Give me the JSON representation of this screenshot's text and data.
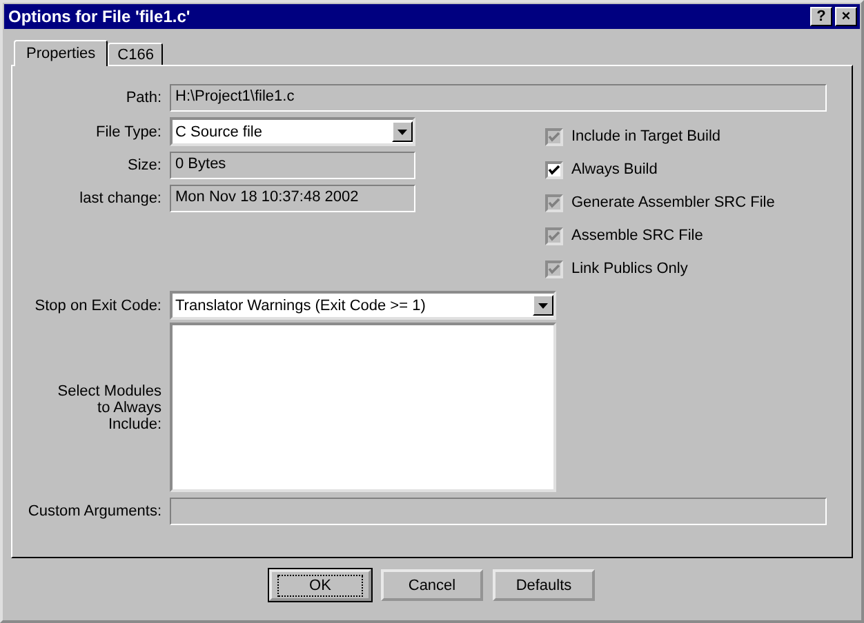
{
  "window": {
    "title": "Options for File 'file1.c'",
    "title_buttons": [
      "?",
      "×"
    ]
  },
  "tabs": [
    {
      "label": "Properties",
      "selected": true
    },
    {
      "label": "C166",
      "selected": false
    }
  ],
  "fields": {
    "path": {
      "label": "Path:",
      "value": "H:\\Project1\\file1.c"
    },
    "file_type": {
      "label": "File Type:",
      "value": "C Source file"
    },
    "size": {
      "label": "Size:",
      "value": "0 Bytes"
    },
    "last_change": {
      "label": "last change:",
      "value": "Mon Nov 18 10:37:48 2002"
    },
    "stop_on_exit_code": {
      "label": "Stop on Exit Code:",
      "value": "Translator Warnings (Exit Code >= 1)"
    },
    "modules": {
      "label": "Select Modules to Always Include:"
    },
    "custom_arguments": {
      "label": "Custom Arguments:"
    }
  },
  "options": [
    {
      "label": "Include in Target Build",
      "checked": true,
      "disabled": true
    },
    {
      "label": "Always Build",
      "checked": true,
      "disabled": false
    },
    {
      "label": "Generate Assembler SRC File",
      "checked": true,
      "disabled": true
    },
    {
      "label": "Assemble SRC File",
      "checked": true,
      "disabled": true
    },
    {
      "label": "Link Publics Only",
      "checked": true,
      "disabled": true
    }
  ],
  "buttons": [
    {
      "label": "OK",
      "default": true
    },
    {
      "label": "Cancel",
      "default": false
    },
    {
      "label": "Defaults",
      "default": false
    }
  ]
}
